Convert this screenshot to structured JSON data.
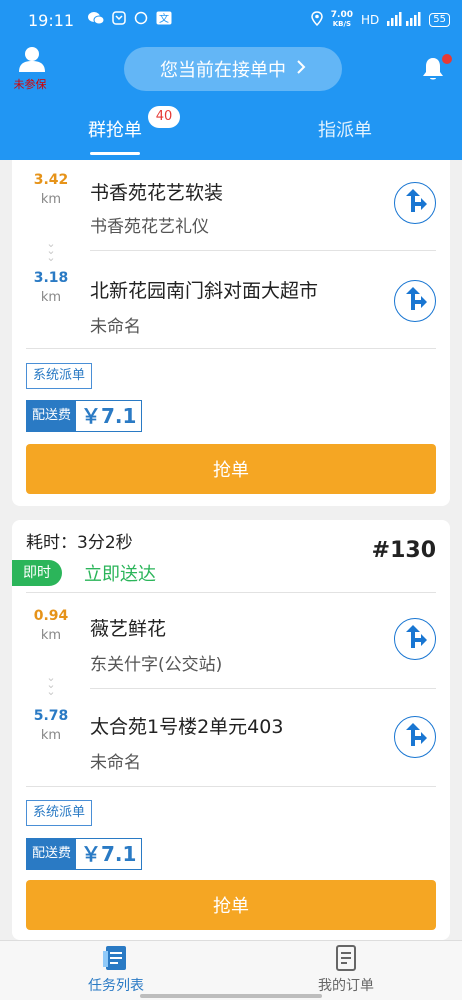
{
  "status_bar": {
    "time": "19:11",
    "speed_value": "7.00",
    "speed_unit": "KB/S",
    "network": "HD",
    "battery": "55"
  },
  "header": {
    "profile_label": "未参保",
    "status_pill": "您当前在接单中",
    "tabs": [
      {
        "label": "群抢单",
        "badge": "40"
      },
      {
        "label": "指派单"
      }
    ]
  },
  "orders": [
    {
      "pickup": {
        "distance": "3.42",
        "unit": "km",
        "name": "书香苑花艺软装",
        "address": "书香苑花艺礼仪"
      },
      "dropoff": {
        "distance": "3.18",
        "unit": "km",
        "name": "北新花园南门斜对面大超市",
        "address": "未命名"
      },
      "tag": "系统派单",
      "fee_label": "配送费",
      "fee": "￥7.1",
      "grab_label": "抢单"
    },
    {
      "elapsed_label": "耗时：3分2秒",
      "order_no": "#130",
      "instant_badge": "即时",
      "instant_text": "立即送达",
      "pickup": {
        "distance": "0.94",
        "unit": "km",
        "name": "薇艺鲜花",
        "address": "东关什字(公交站)"
      },
      "dropoff": {
        "distance": "5.78",
        "unit": "km",
        "name": "太合苑1号楼2单元403",
        "address": "未命名"
      },
      "tag": "系统派单",
      "fee_label": "配送费",
      "fee": "￥7.1",
      "grab_label": "抢单"
    }
  ],
  "bottom_nav": [
    {
      "label": "任务列表",
      "icon": "task-list-icon",
      "active": true
    },
    {
      "label": "我的订单",
      "icon": "my-orders-icon",
      "active": false
    }
  ],
  "colors": {
    "primary": "#2196f3",
    "accent_orange": "#f5a623",
    "pickup_distance": "#e69319",
    "dropoff_distance": "#2a7ac4",
    "instant_green": "#2bb55a"
  }
}
